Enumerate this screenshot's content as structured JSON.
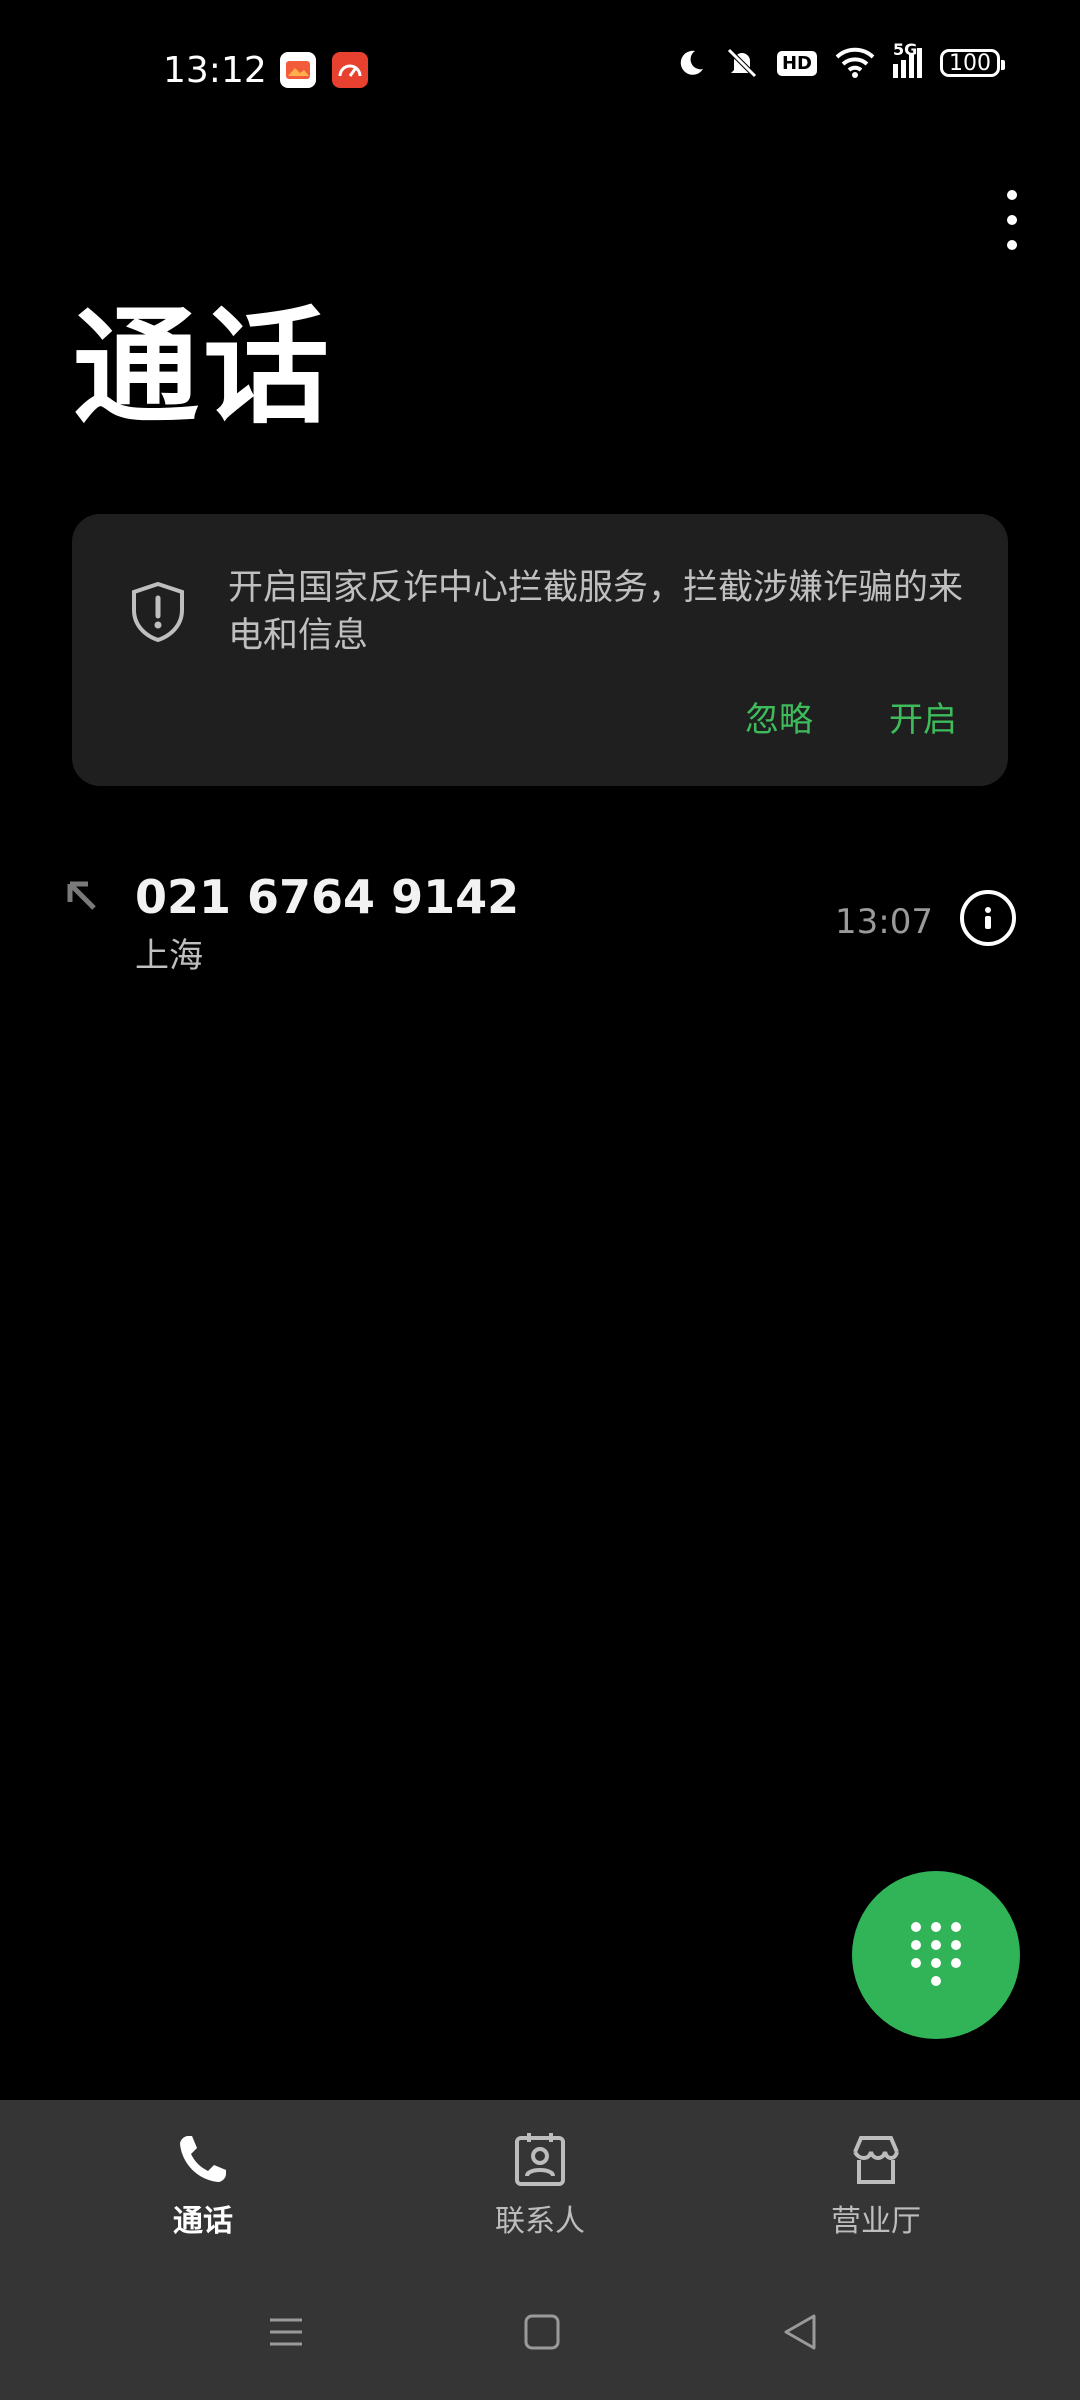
{
  "status_bar": {
    "time": "13:12",
    "battery": "100",
    "network": "5G",
    "hd_badge": "HD",
    "icons": [
      "photo-app-icon",
      "speed-app-icon",
      "moon-icon",
      "mute-bell-icon",
      "hd-icon",
      "wifi-icon",
      "signal-icon",
      "battery-icon"
    ]
  },
  "header": {
    "title": "通话",
    "more_icon": "more-vertical-icon"
  },
  "banner": {
    "text": "开启国家反诈中心拦截服务，拦截涉嫌诈骗的来电和信息",
    "ignore_label": "忽略",
    "enable_label": "开启",
    "icon": "shield-alert-icon",
    "accent_color": "#3ebc5c"
  },
  "call_log": [
    {
      "number": "021 6764 9142",
      "location": "上海",
      "time": "13:07",
      "direction_icon": "outgoing-call-arrow-icon",
      "info_icon": "info-icon"
    }
  ],
  "fab": {
    "icon": "dialpad-icon",
    "color": "#30b457"
  },
  "bottom_nav": {
    "items": [
      {
        "label": "通话",
        "icon": "phone-icon",
        "active": true
      },
      {
        "label": "联系人",
        "icon": "contacts-icon",
        "active": false
      },
      {
        "label": "营业厅",
        "icon": "store-icon",
        "active": false
      }
    ]
  },
  "system_nav": {
    "icons": [
      "menu-icon",
      "home-square-icon",
      "back-triangle-icon"
    ]
  }
}
